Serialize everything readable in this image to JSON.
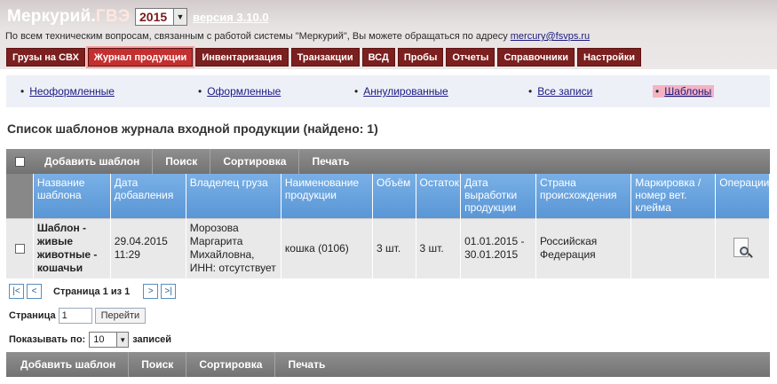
{
  "header": {
    "brand_main": "Меркурий.",
    "brand_sub": "ГВЭ",
    "year": "2015",
    "version": "версия 3.10.0",
    "support_text": "По всем техническим вопросам, связанным с работой системы \"Меркурий\", Вы можете обращаться по адресу",
    "support_email": "mercury@fsvps.ru"
  },
  "topnav": [
    {
      "label": "Грузы на СВХ"
    },
    {
      "label": "Журнал продукции",
      "active": true
    },
    {
      "label": "Инвентаризация"
    },
    {
      "label": "Транзакции"
    },
    {
      "label": "ВСД"
    },
    {
      "label": "Пробы"
    },
    {
      "label": "Отчеты"
    },
    {
      "label": "Справочники"
    },
    {
      "label": "Настройки"
    }
  ],
  "subnav": [
    {
      "label": "Неоформленные"
    },
    {
      "label": "Оформленные"
    },
    {
      "label": "Аннулированные"
    },
    {
      "label": "Все записи"
    },
    {
      "label": "Шаблоны",
      "active": true
    }
  ],
  "page_title": "Список шаблонов журнала входной продукции (найдено: 1)",
  "toolbar": {
    "add": "Добавить шаблон",
    "search": "Поиск",
    "sort": "Сортировка",
    "print": "Печать"
  },
  "table": {
    "headers": {
      "name": "Название шаблона",
      "date_added": "Дата добавления",
      "owner": "Владелец груза",
      "product": "Наименование продукции",
      "volume": "Объём",
      "remainder": "Остаток",
      "production_date": "Дата выработки продукции",
      "country": "Страна происхождения",
      "marking": "Маркировка / номер вет. клейма",
      "operations": "Операции"
    },
    "rows": [
      {
        "name": "Шаблон - живые животные - кошачьи",
        "date_added": "29.04.2015 11:29",
        "owner": "Морозова Маргарита Михайловна, ИНН: отсутствует",
        "product": "кошка (0106)",
        "volume": "3 шт.",
        "remainder": "3 шт.",
        "production_date": "01.01.2015 - 30.01.2015",
        "country": "Российская Федерация",
        "marking": "",
        "operation_icon": "view-document-icon"
      }
    ]
  },
  "pager": {
    "first": "|<",
    "prev": "<",
    "info": "Страница 1 из 1",
    "next": ">",
    "last": ">|",
    "goto_label": "Страница",
    "goto_value": "1",
    "goto_button": "Перейти",
    "perpage_label": "Показывать по:",
    "perpage_value": "10",
    "perpage_suffix": "записей"
  },
  "colors": {
    "nav_tab": "#7b1f1f",
    "nav_tab_active": "#c43030",
    "table_header": "#5a96d6",
    "toolbar": "#7f7f7f"
  }
}
